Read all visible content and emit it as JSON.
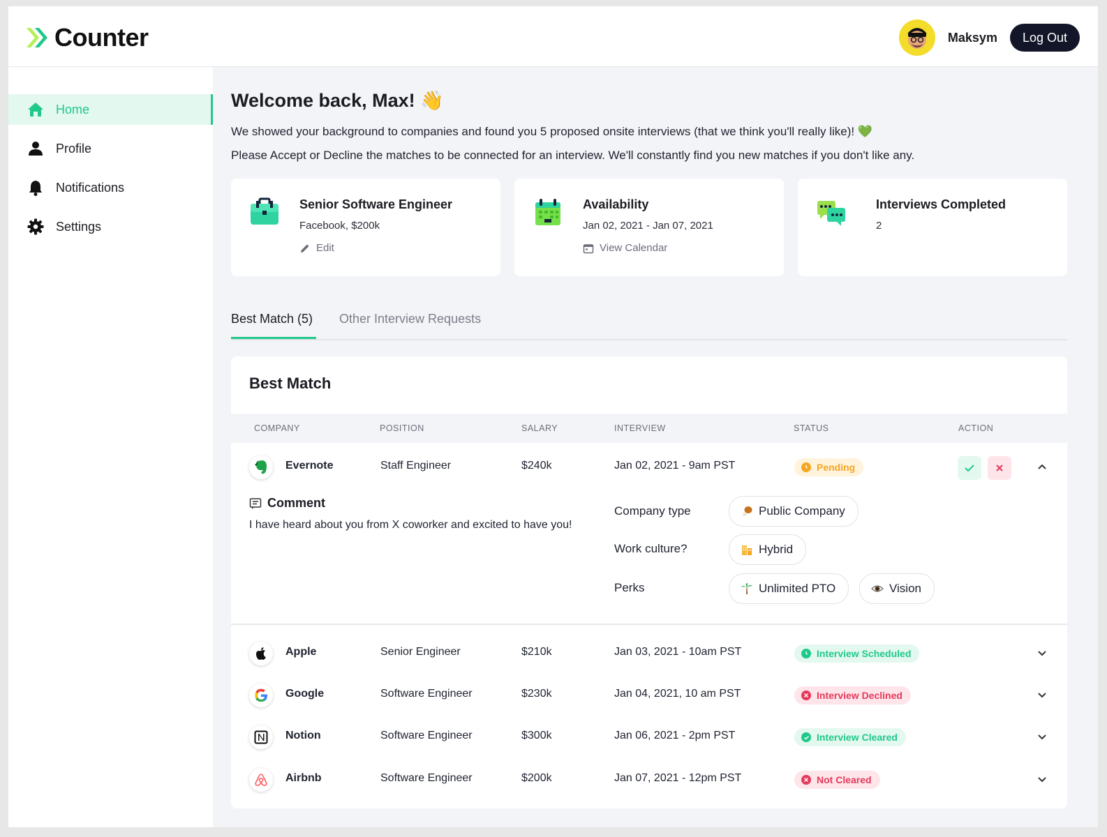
{
  "app": {
    "brand": "Counter"
  },
  "header": {
    "user_name": "Maksym",
    "logout_label": "Log Out"
  },
  "sidebar": {
    "items": [
      {
        "label": "Home",
        "icon": "home-icon",
        "active": true
      },
      {
        "label": "Profile",
        "icon": "user-icon",
        "active": false
      },
      {
        "label": "Notifications",
        "icon": "bell-icon",
        "active": false
      },
      {
        "label": "Settings",
        "icon": "gear-icon",
        "active": false
      }
    ]
  },
  "welcome": {
    "title": "Welcome back, Max! 👋",
    "line1": "We showed your background to companies and found you 5 proposed onsite interviews (that we think you'll really like)! 💚",
    "line2": "Please Accept or Decline the matches to be connected for an interview. We'll constantly find you new matches if you don't like any."
  },
  "cards": [
    {
      "title": "Senior Software Engineer",
      "sub": "Facebook, $200k",
      "link": "Edit",
      "icon": "briefcase-icon",
      "link_icon": "pencil-icon"
    },
    {
      "title": "Availability",
      "sub": "Jan 02, 2021 - Jan 07, 2021",
      "link": "View Calendar",
      "icon": "calendar-icon",
      "link_icon": "calendar-small-icon"
    },
    {
      "title": "Interviews Completed",
      "sub": "2",
      "icon": "chat-bubbles-icon"
    }
  ],
  "tabs": [
    {
      "label": "Best Match (5)",
      "active": true
    },
    {
      "label": "Other Interview Requests",
      "active": false
    }
  ],
  "table": {
    "title": "Best Match",
    "columns": [
      "COMPANY",
      "POSITION",
      "SALARY",
      "INTERVIEW",
      "STATUS",
      "ACTION"
    ],
    "rows": [
      {
        "company": "Evernote",
        "position": "Staff Engineer",
        "salary": "$240k",
        "interview": "Jan 02, 2021 - 9am PST",
        "status": "Pending",
        "status_color": "#f5a623",
        "status_bg": "#fff3dc",
        "expanded": true
      },
      {
        "company": "Apple",
        "position": "Senior Engineer",
        "salary": "$210k",
        "interview": "Jan 03, 2021 - 10am PST",
        "status": "Interview Scheduled",
        "status_color": "#1fc98a",
        "status_bg": "#e3f8ef"
      },
      {
        "company": "Google",
        "position": "Software Engineer",
        "salary": "$230k",
        "interview": "Jan 04, 2021, 10 am PST",
        "status": "Interview Declined",
        "status_color": "#e5395b",
        "status_bg": "#fde5ea"
      },
      {
        "company": "Notion",
        "position": "Software Engineer",
        "salary": "$300k",
        "interview": "Jan 06, 2021 - 2pm PST",
        "status": "Interview Cleared",
        "status_color": "#1fc98a",
        "status_bg": "#e3f8ef"
      },
      {
        "company": "Airbnb",
        "position": "Software Engineer",
        "salary": "$200k",
        "interview": "Jan 07, 2021 - 12pm PST",
        "status": "Not Cleared",
        "status_color": "#e5395b",
        "status_bg": "#fde5ea"
      }
    ],
    "detail": {
      "comment_title": "Comment",
      "comment_text": "I have heard about you from X coworker and excited to have you!",
      "company_type_label": "Company type",
      "company_type": "Public Company",
      "work_culture_label": "Work culture?",
      "work_culture": "Hybrid",
      "perks_label": "Perks",
      "perks": [
        "Unlimited PTO",
        "Vision"
      ]
    }
  },
  "colors": {
    "accent": "#1fc98a",
    "dark": "#121628",
    "warning": "#f5a623",
    "danger": "#e5395b"
  }
}
